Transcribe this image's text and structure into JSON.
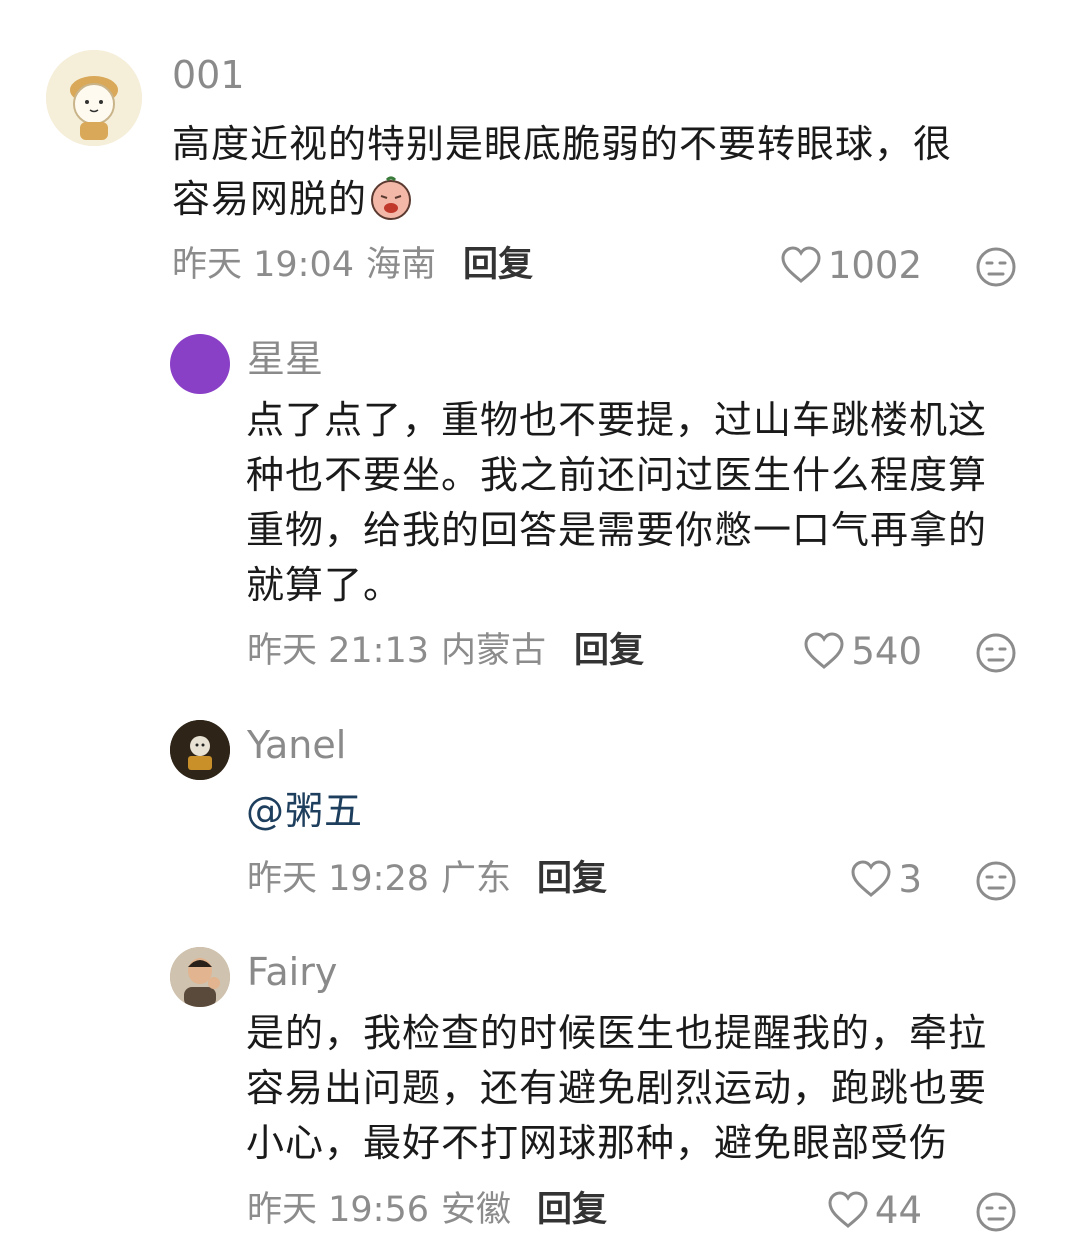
{
  "comments": [
    {
      "username": "001",
      "lines": [
        "高度近视的特别是眼底脆弱的不要转眼球，很",
        "容易网脱的"
      ],
      "emoji": "crying-face-emoji",
      "time": "昨天 19:04",
      "location": "海南",
      "reply_label": "回复",
      "likes": "1002"
    },
    {
      "username": "星星",
      "lines": [
        "点了点了，重物也不要提，过山车跳楼机这",
        "种也不要坐。我之前还问过医生什么程度算",
        "重物，给我的回答是需要你憋一口气再拿的",
        "就算了。"
      ],
      "time": "昨天 21:13",
      "location": "内蒙古",
      "reply_label": "回复",
      "likes": "540"
    },
    {
      "username": "Yanel",
      "lines": [
        "@粥五"
      ],
      "time": "昨天 19:28",
      "location": "广东",
      "reply_label": "回复",
      "likes": "3"
    },
    {
      "username": "Fairy",
      "lines": [
        "是的，我检查的时候医生也提醒我的，牵拉",
        "容易出问题，还有避免剧烈运动，跑跳也要",
        "小心，最好不打网球那种，避免眼部受伤"
      ],
      "time": "昨天 19:56",
      "location": "安徽",
      "reply_label": "回复",
      "likes": "44"
    }
  ],
  "icons": {
    "like": "heart-outline-icon",
    "dislike": "neutral-face-icon"
  },
  "colors": {
    "accent_purple": "#8a3fc7",
    "meta_gray": "#8c8c8c",
    "mention_blue": "#1d3e5c"
  }
}
